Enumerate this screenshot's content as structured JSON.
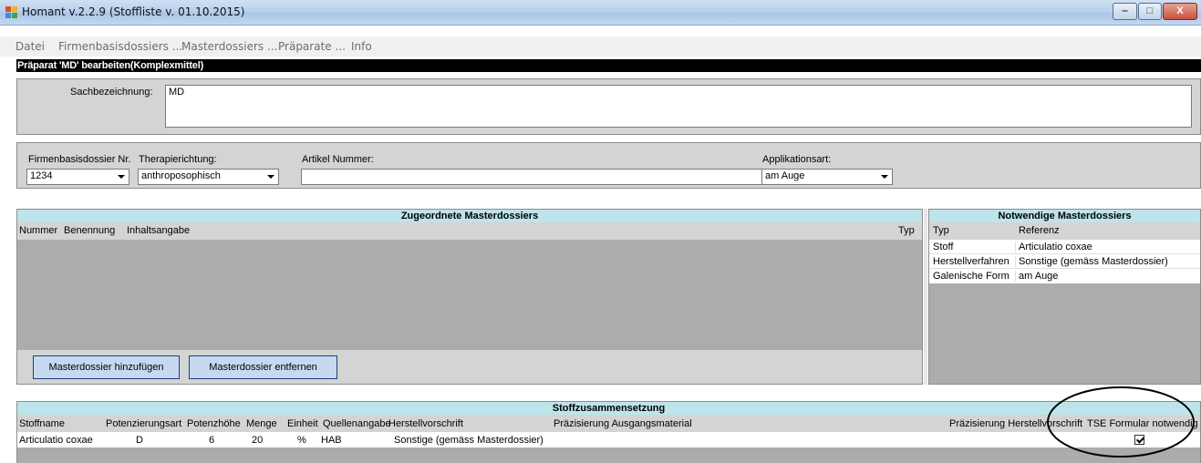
{
  "window": {
    "title": "Homant v.2.2.9 (Stoffliste v. 01.10.2015)",
    "min_label": "‒",
    "max_label": "□",
    "close_label": "X"
  },
  "menu": {
    "items": [
      "Datei",
      "Firmenbasisdossiers ...",
      "Masterdossiers ...",
      "Präparate ...",
      "Info"
    ]
  },
  "header": {
    "title": "Präparat 'MD' bearbeiten(Komplexmittel)"
  },
  "sachbezeichnung": {
    "label": "Sachbezeichnung:",
    "value": "MD"
  },
  "fields": {
    "firmenbasisdossier": {
      "label": "Firmenbasisdossier Nr.",
      "value": "1234"
    },
    "therapierichtung": {
      "label": "Therapierichtung:",
      "value": "anthroposophisch"
    },
    "artikel_nummer": {
      "label": "Artikel Nummer:",
      "value": ""
    },
    "applikationsart": {
      "label": "Applikationsart:",
      "value": "am Auge"
    }
  },
  "zugeordnete": {
    "title": "Zugeordnete Masterdossiers",
    "columns": [
      "Nummer",
      "Benennung",
      "Inhaltsangabe",
      "Typ"
    ],
    "add_button": "Masterdossier hinzufügen",
    "remove_button": "Masterdossier entfernen"
  },
  "notwendige": {
    "title": "Notwendige Masterdossiers",
    "columns": [
      "Typ",
      "Referenz"
    ],
    "rows": [
      [
        "Stoff",
        "Articulatio coxae"
      ],
      [
        "Herstellverfahren",
        "Sonstige (gemäss Masterdossier)"
      ],
      [
        "Galenische Form",
        "am Auge"
      ]
    ]
  },
  "stoff": {
    "title": "Stoffzusammensetzung",
    "columns": [
      "Stoffname",
      "Potenzierungsart",
      "Potenzhöhe",
      "Menge",
      "Einheit",
      "Quellenangabe",
      "Herstellvorschrift",
      "Präzisierung Ausgangsmaterial",
      "Präzisierung Herstellvorschrift",
      "TSE Formular notwendig"
    ],
    "rows": [
      {
        "stoffname": "Articulatio coxae",
        "potenzierungsart": "D",
        "potenzhoehe": "6",
        "menge": "20",
        "einheit": "%",
        "quellenangabe": "HAB",
        "herstellvorschrift": "Sonstige (gemäss Masterdossier)",
        "praez_ausgang": "",
        "praez_herstell": "",
        "tse": true
      }
    ]
  },
  "colors": {
    "grid_title": "#bde4ea",
    "panel": "#d4d4d4",
    "grid_body": "#acacac",
    "button": "#c6d9f1"
  }
}
